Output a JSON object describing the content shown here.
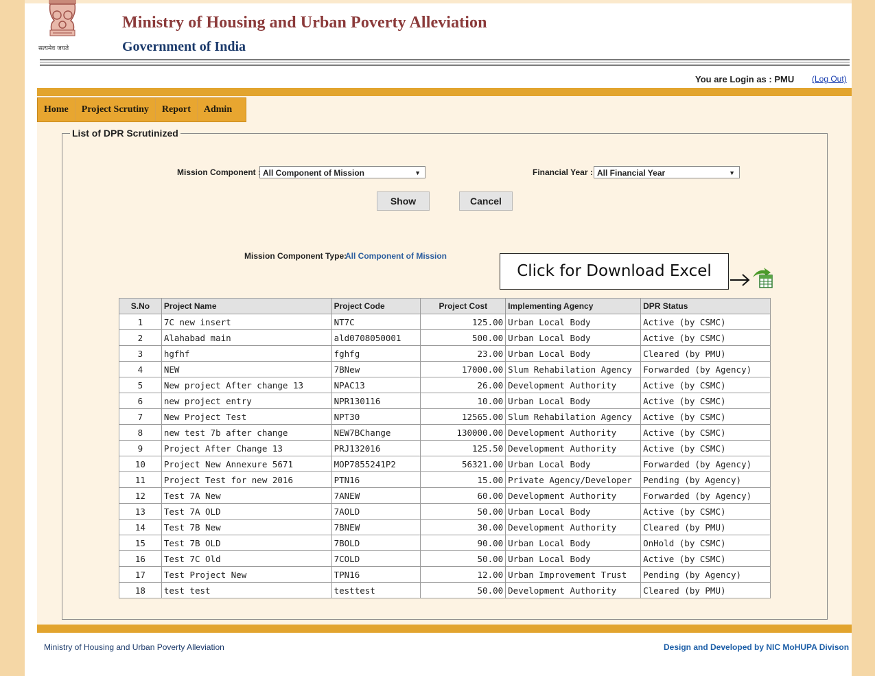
{
  "header": {
    "title": "Ministry of Housing and Urban Poverty Alleviation",
    "subtitle": "Government of India",
    "emblem_caption": "सत्यमेव जयते"
  },
  "login": {
    "text": "You are Login as : PMU",
    "logout_label": "(Log Out)"
  },
  "menu": {
    "items": [
      "Home",
      "Project Scrutiny",
      "Report",
      "Admin"
    ]
  },
  "section": {
    "legend": "List of DPR Scrutinized"
  },
  "filters": {
    "mission_label": "Mission Component :",
    "mission_value": "All Component of Mission",
    "year_label": "Financial Year :",
    "year_value": "All Financial Year"
  },
  "buttons": {
    "show": "Show",
    "cancel": "Cancel"
  },
  "summary": {
    "type_label": "Mission Component Type:",
    "type_value": "All Component of Mission"
  },
  "callout": {
    "text": "Click for Download Excel"
  },
  "table": {
    "headers": [
      "S.No",
      "Project Name",
      "Project Code",
      "Project Cost",
      "Implementing Agency",
      "DPR Status"
    ],
    "rows": [
      [
        "1",
        "7C new insert",
        "NT7C",
        "125.00",
        "Urban Local Body",
        "Active (by CSMC)"
      ],
      [
        "2",
        "Alahabad main",
        "ald0708050001",
        "500.00",
        "Urban Local Body",
        "Active (by CSMC)"
      ],
      [
        "3",
        "hgfhf",
        "fghfg",
        "23.00",
        "Urban Local Body",
        "Cleared (by PMU)"
      ],
      [
        "4",
        "NEW",
        "7BNew",
        "17000.00",
        "Slum Rehabilation Agency",
        "Forwarded (by Agency)"
      ],
      [
        "5",
        "New project After change 13",
        "NPAC13",
        "26.00",
        "Development Authority",
        "Active (by CSMC)"
      ],
      [
        "6",
        "new project entry",
        "NPR130116",
        "10.00",
        "Urban Local Body",
        "Active (by CSMC)"
      ],
      [
        "7",
        "New Project Test",
        "NPT30",
        "12565.00",
        "Slum Rehabilation Agency",
        "Active (by CSMC)"
      ],
      [
        "8",
        "new test 7b after change",
        "NEW7BChange",
        "130000.00",
        "Development Authority",
        "Active (by CSMC)"
      ],
      [
        "9",
        "Project After Change 13",
        "PRJ132016",
        "125.50",
        "Development Authority",
        "Active (by CSMC)"
      ],
      [
        "10",
        "Project New Annexure 5671",
        "MOP7855241P2",
        "56321.00",
        "Urban Local Body",
        "Forwarded (by Agency)"
      ],
      [
        "11",
        "Project Test for new 2016",
        "PTN16",
        "15.00",
        "Private Agency/Developer",
        "Pending (by Agency)"
      ],
      [
        "12",
        "Test 7A New",
        "7ANEW",
        "60.00",
        "Development Authority",
        "Forwarded (by Agency)"
      ],
      [
        "13",
        "Test 7A OLD",
        "7AOLD",
        "50.00",
        "Urban Local Body",
        "Active (by CSMC)"
      ],
      [
        "14",
        "Test 7B New",
        "7BNEW",
        "30.00",
        "Development Authority",
        "Cleared (by PMU)"
      ],
      [
        "15",
        "Test 7B OLD",
        "7BOLD",
        "90.00",
        "Urban Local Body",
        "OnHold (by CSMC)"
      ],
      [
        "16",
        "Test 7C Old",
        "7COLD",
        "50.00",
        "Urban Local Body",
        "Active (by CSMC)"
      ],
      [
        "17",
        "Test Project New",
        "TPN16",
        "12.00",
        "Urban Improvement Trust",
        "Pending (by Agency)"
      ],
      [
        "18",
        "test test",
        "testtest",
        "50.00",
        "Development Authority",
        "Cleared (by PMU)"
      ]
    ]
  },
  "footer": {
    "left": "Ministry of Housing and Urban Poverty Alleviation",
    "right": "Design and Developed by NIC MoHUPA Divison"
  },
  "colors": {
    "accent_orange": "#e2a42e",
    "side_band": "#f5d7a6",
    "content_bg": "#fdf3e3",
    "title_maroon": "#8b3a3a",
    "title_navy": "#1b3a6b"
  }
}
